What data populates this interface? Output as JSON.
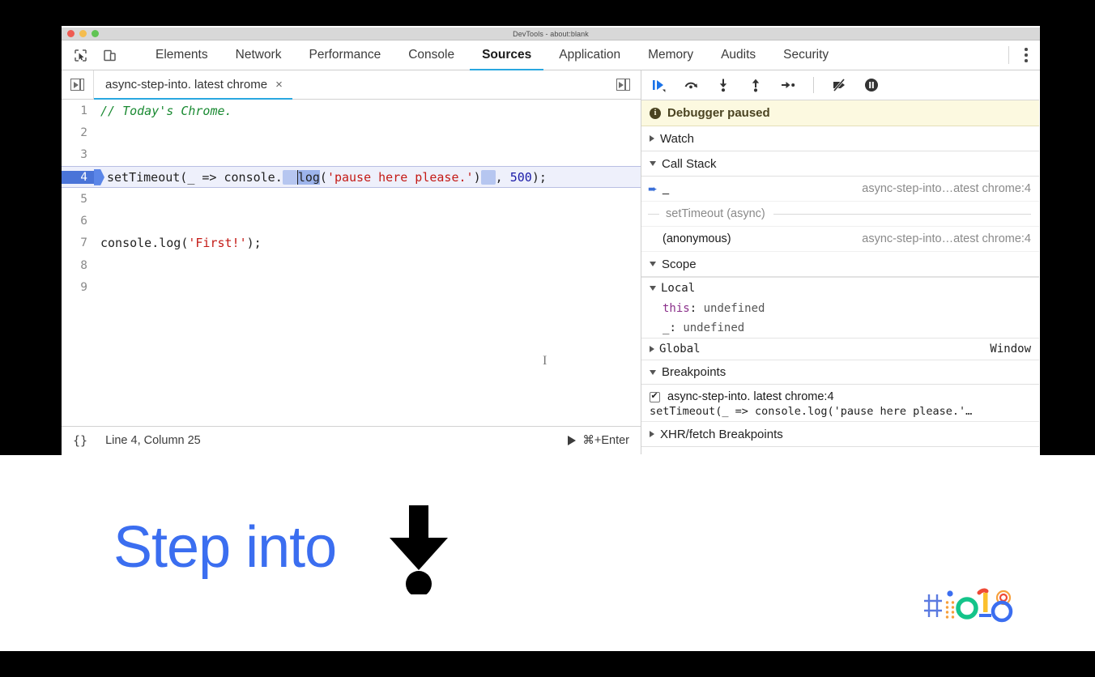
{
  "window": {
    "title": "DevTools - about:blank",
    "traffic_lights": [
      "close",
      "minimize",
      "zoom"
    ]
  },
  "mainnav": {
    "tools": [
      "inspect-element-icon",
      "device-toolbar-icon"
    ],
    "tabs": [
      {
        "label": "Elements",
        "active": false
      },
      {
        "label": "Network",
        "active": false
      },
      {
        "label": "Performance",
        "active": false
      },
      {
        "label": "Console",
        "active": false
      },
      {
        "label": "Sources",
        "active": true
      },
      {
        "label": "Application",
        "active": false
      },
      {
        "label": "Memory",
        "active": false
      },
      {
        "label": "Audits",
        "active": false
      },
      {
        "label": "Security",
        "active": false
      }
    ],
    "more_label": "kebab-menu"
  },
  "sources": {
    "file_tab": {
      "label": "async-step-into. latest chrome",
      "close": "×"
    },
    "sidebar_toggle": "show-navigator-icon",
    "panel_toggle": "show-debugger-icon",
    "code_lines": [
      {
        "num": "1",
        "segments": [
          {
            "t": "// Today's Chrome.",
            "c": "tok-comment"
          }
        ]
      },
      {
        "num": "2",
        "segments": []
      },
      {
        "num": "3",
        "segments": []
      },
      {
        "num": "4",
        "highlight": true,
        "segments": [
          {
            "t": "setTimeout(_ => console.",
            "c": "tok-plain"
          },
          {
            "t": "log",
            "c": "tok-plain"
          },
          {
            "t": "(",
            "c": "tok-plain"
          },
          {
            "t": "'pause here please.'",
            "c": "tok-str"
          },
          {
            "t": ")",
            "c": "tok-plain"
          },
          {
            "t": ", ",
            "c": "tok-plain"
          },
          {
            "t": "500",
            "c": "tok-num"
          },
          {
            "t": ");",
            "c": "tok-plain"
          }
        ]
      },
      {
        "num": "5",
        "segments": []
      },
      {
        "num": "6",
        "segments": []
      },
      {
        "num": "7",
        "segments": [
          {
            "t": "console.log(",
            "c": "tok-plain"
          },
          {
            "t": "'First!'",
            "c": "tok-str"
          },
          {
            "t": ");",
            "c": "tok-plain"
          }
        ]
      },
      {
        "num": "8",
        "segments": []
      },
      {
        "num": "9",
        "segments": []
      }
    ],
    "statusbar": {
      "format_icon": "{}",
      "position": "Line 4, Column 25",
      "run_shortcut": "⌘+Enter"
    }
  },
  "debugger": {
    "toolbar": [
      "resume-script-execution-icon",
      "step-over-next-function-call-icon",
      "step-into-next-function-call-icon",
      "step-out-of-current-function-icon",
      "step-icon",
      "deactivate-breakpoints-icon",
      "pause-on-exceptions-icon"
    ],
    "paused_banner": "Debugger paused",
    "watch": {
      "label": "Watch",
      "expanded": false
    },
    "call_stack": {
      "label": "Call Stack",
      "expanded": true,
      "frames": [
        {
          "name": "_",
          "location": "async-step-into…atest chrome:4",
          "current": true,
          "async": false
        },
        {
          "name": "setTimeout (async)",
          "location": "",
          "current": false,
          "async": true
        },
        {
          "name": "(anonymous)",
          "location": "async-step-into…atest chrome:4",
          "current": false,
          "async": false
        }
      ]
    },
    "scope": {
      "label": "Scope",
      "expanded": true,
      "groups": [
        {
          "name": "Local",
          "expanded": true,
          "value": "",
          "entries": [
            {
              "key": "this",
              "sep": ":",
              "value": "undefined"
            },
            {
              "key": "_",
              "sep": ":",
              "value": "undefined"
            }
          ]
        },
        {
          "name": "Global",
          "expanded": false,
          "value": "Window",
          "entries": []
        }
      ]
    },
    "breakpoints": {
      "label": "Breakpoints",
      "expanded": true,
      "items": [
        {
          "checked": true,
          "label": "async-step-into. latest chrome:4",
          "code": "setTimeout(_ => console.log('pause here please.'…"
        }
      ]
    },
    "xhr_breakpoints": {
      "label": "XHR/fetch Breakpoints",
      "expanded": false
    }
  },
  "slide": {
    "caption": "Step into",
    "caption_color": "#3b6ef0",
    "arrow_icon": "step-into-arrow-icon",
    "logo": "google-io-2018-logo"
  }
}
